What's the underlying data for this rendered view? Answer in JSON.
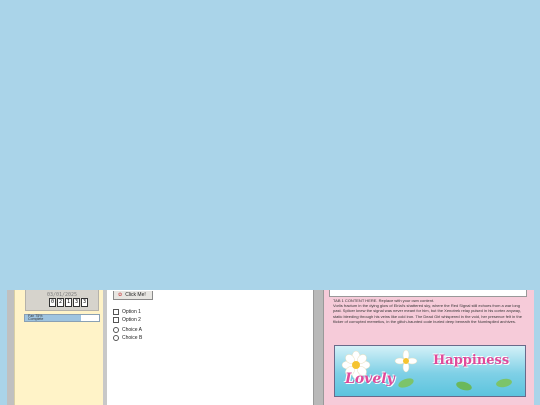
{
  "sidebar": {
    "date": "03/01/2025",
    "counter_digits": [
      "0",
      "2",
      "1",
      "3",
      "3"
    ],
    "progress": {
      "label": "Fan 75% Complete",
      "fraction": 0.75
    }
  },
  "middle": {
    "button_label": "Click Me!",
    "checkboxes": [
      "Option 1",
      "Option 2"
    ],
    "radios": [
      "Choice A",
      "Choice B"
    ]
  },
  "right": {
    "tab_content": "TAB 1 CONTENT HERE. Replace with your own content.\nVorlis fractum in the dying glow of Elrial's shattered sky, where the Red Signal still echoes from a war long past. Splicer knew the signal was never meant for him, but the Xenotrek relay pulsed in his cortex anyway, static bleeding through his veins like cold iron. The Dead Girl whispered in the void, her presence felt in the flicker of corrupted memetics, in the glitch-haunted code buried deep beneath the Numbspiled archives.",
    "banner": {
      "word_left": "Lovely",
      "word_right": "Happiness"
    }
  },
  "colors": {
    "background": "#aad4e9",
    "sidebar": "#fff3c8",
    "right_panel": "#f6cbd9",
    "banner_text": "#e04a9a"
  }
}
